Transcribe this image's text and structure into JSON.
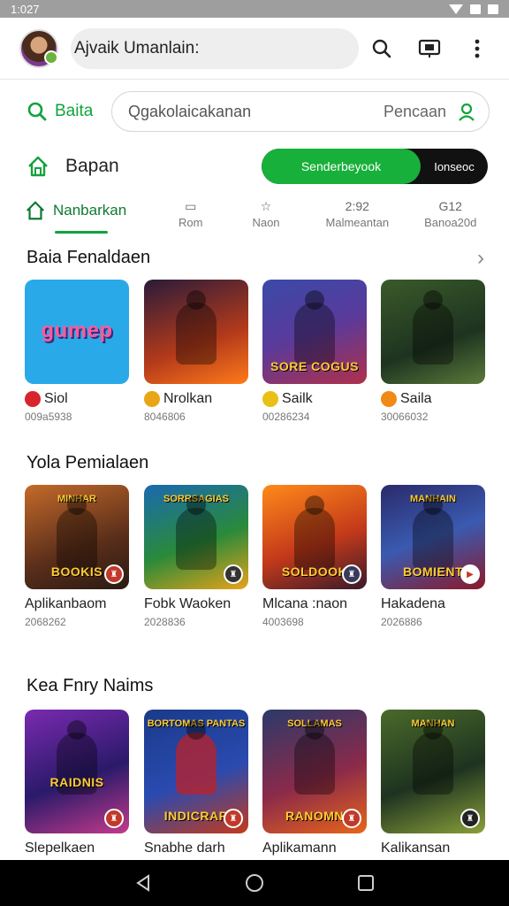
{
  "status_bar": {
    "time": "1:027"
  },
  "header": {
    "account_name": "Ajvaik Umanlain:"
  },
  "search": {
    "brand": "Baita",
    "placeholder": "Qgakolaicakanan",
    "trailing": "Pencaan"
  },
  "home": {
    "title": "Bapan",
    "toggle_on": "Senderbeyook",
    "toggle_off": "Ionseoc"
  },
  "tabs": [
    {
      "label": "Nanbarkan"
    },
    {
      "label": "Rom"
    },
    {
      "label": "Naon"
    },
    {
      "label": "2:92",
      "sub": "Malmeantan"
    },
    {
      "label": "G12",
      "sub": "Banoa20d"
    }
  ],
  "sections": [
    {
      "title": "Baia Fenaldaen",
      "items": [
        {
          "name": "Siol",
          "sub": "009a5938",
          "caption": "gumep"
        },
        {
          "name": "Nrolkan",
          "sub": "8046806",
          "caption": ""
        },
        {
          "name": "Sailk",
          "sub": "00286234",
          "caption": "SORE COGUS"
        },
        {
          "name": "Saila",
          "sub": "30066032",
          "caption": ""
        }
      ]
    },
    {
      "title": "Yola Pemialaen",
      "items": [
        {
          "name": "Aplikanbaom",
          "sub": "2068262",
          "caption": "BOOKIS",
          "topcap": "MINHAR"
        },
        {
          "name": "Fobk Waoken",
          "sub": "2028836",
          "caption": "",
          "topcap": "SORRSAGIAS"
        },
        {
          "name": "Mlcana :naon",
          "sub": "4003698",
          "caption": "SOLDOOK",
          "topcap": ""
        },
        {
          "name": "Hakadena",
          "sub": "2026886",
          "caption": "BOMIENT",
          "topcap": "MANHAIN"
        }
      ]
    },
    {
      "title": "Kea Fnry Naims",
      "items": [
        {
          "name": "Slepelkaen",
          "sub": "",
          "caption": "RAIDNIS",
          "topcap": ""
        },
        {
          "name": "Snabhe darh",
          "sub": "",
          "caption": "INDICRAR",
          "topcap": "BORTOMAS PANTAS"
        },
        {
          "name": "Aplikamann",
          "sub": "",
          "caption": "RANOMN",
          "topcap": "SOLLAMAS"
        },
        {
          "name": "Kalikansan",
          "sub": "",
          "caption": "",
          "topcap": "MANHAN"
        }
      ]
    }
  ]
}
